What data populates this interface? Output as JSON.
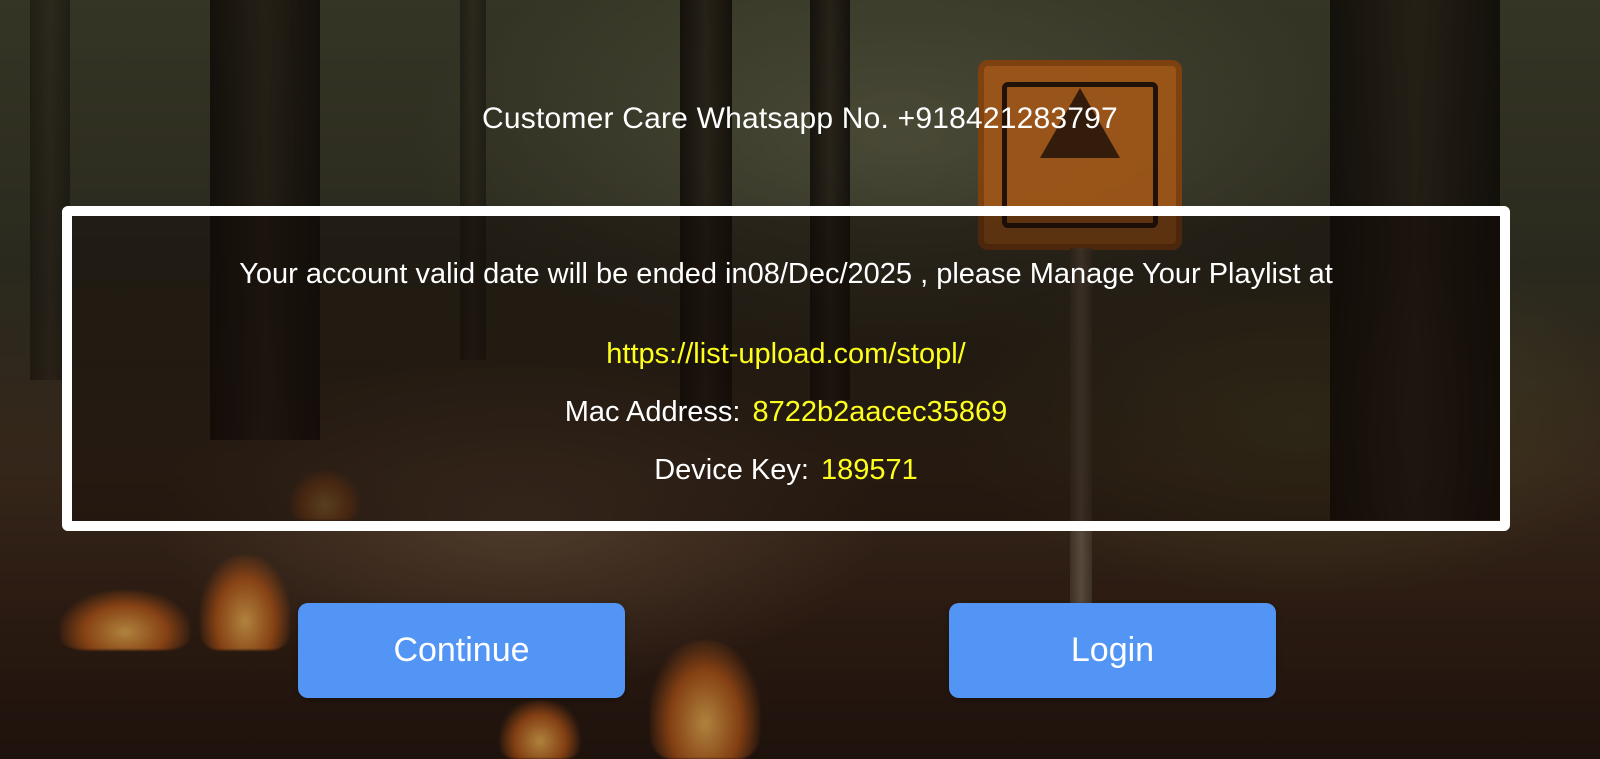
{
  "header": {
    "customer_care": "Customer Care Whatsapp No. +918421283797"
  },
  "info_panel": {
    "message": "Your account valid date will be ended in08/Dec/2025 , please Manage Your Playlist at",
    "url": "https://list-upload.com/stopl/",
    "mac_label": "Mac Address:",
    "mac_value": "8722b2aacec35869",
    "device_key_label": "Device Key:",
    "device_key_value": "189571"
  },
  "actions": {
    "continue_label": "Continue",
    "login_label": "Login"
  },
  "colors": {
    "accent_button": "#5295f5",
    "highlight_text": "#ffff1e",
    "panel_border": "#ffffff"
  },
  "background": {
    "icon": "forest-trail-image"
  }
}
